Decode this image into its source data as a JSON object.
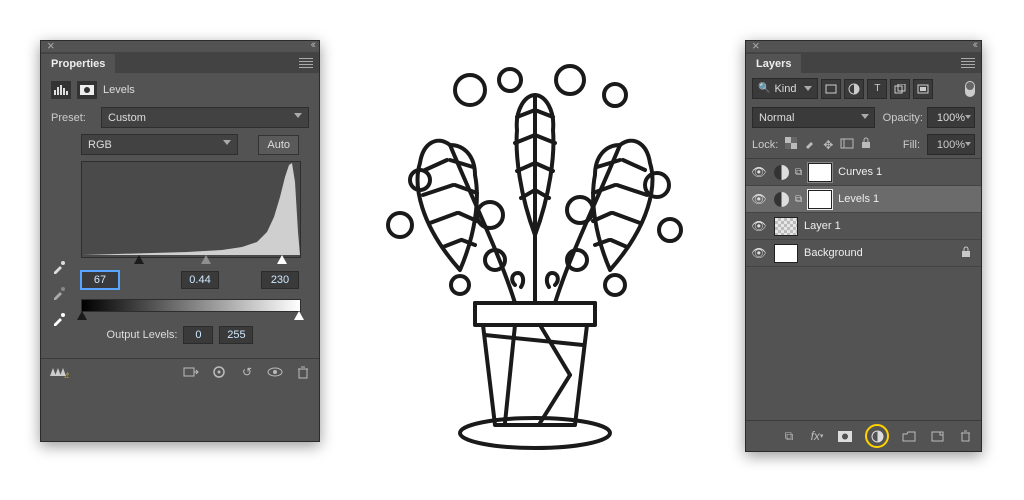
{
  "properties": {
    "tab": "Properties",
    "adjustment_label": "Levels",
    "preset_label": "Preset:",
    "preset_value": "Custom",
    "channel_value": "RGB",
    "auto_label": "Auto",
    "shadow_input": "67",
    "mid_input": "0.44",
    "high_input": "230",
    "output_label": "Output Levels:",
    "output_low": "0",
    "output_high": "255"
  },
  "layers": {
    "tab": "Layers",
    "filter_label": "Kind",
    "blend_mode": "Normal",
    "opacity_label": "Opacity:",
    "opacity_value": "100%",
    "lock_label": "Lock:",
    "fill_label": "Fill:",
    "fill_value": "100%",
    "items": [
      {
        "name": "Curves 1",
        "type": "adj",
        "selected": false
      },
      {
        "name": "Levels 1",
        "type": "adj",
        "selected": true
      },
      {
        "name": "Layer 1",
        "type": "layer",
        "selected": false
      },
      {
        "name": "Background",
        "type": "bg",
        "selected": false,
        "locked": true
      }
    ]
  }
}
